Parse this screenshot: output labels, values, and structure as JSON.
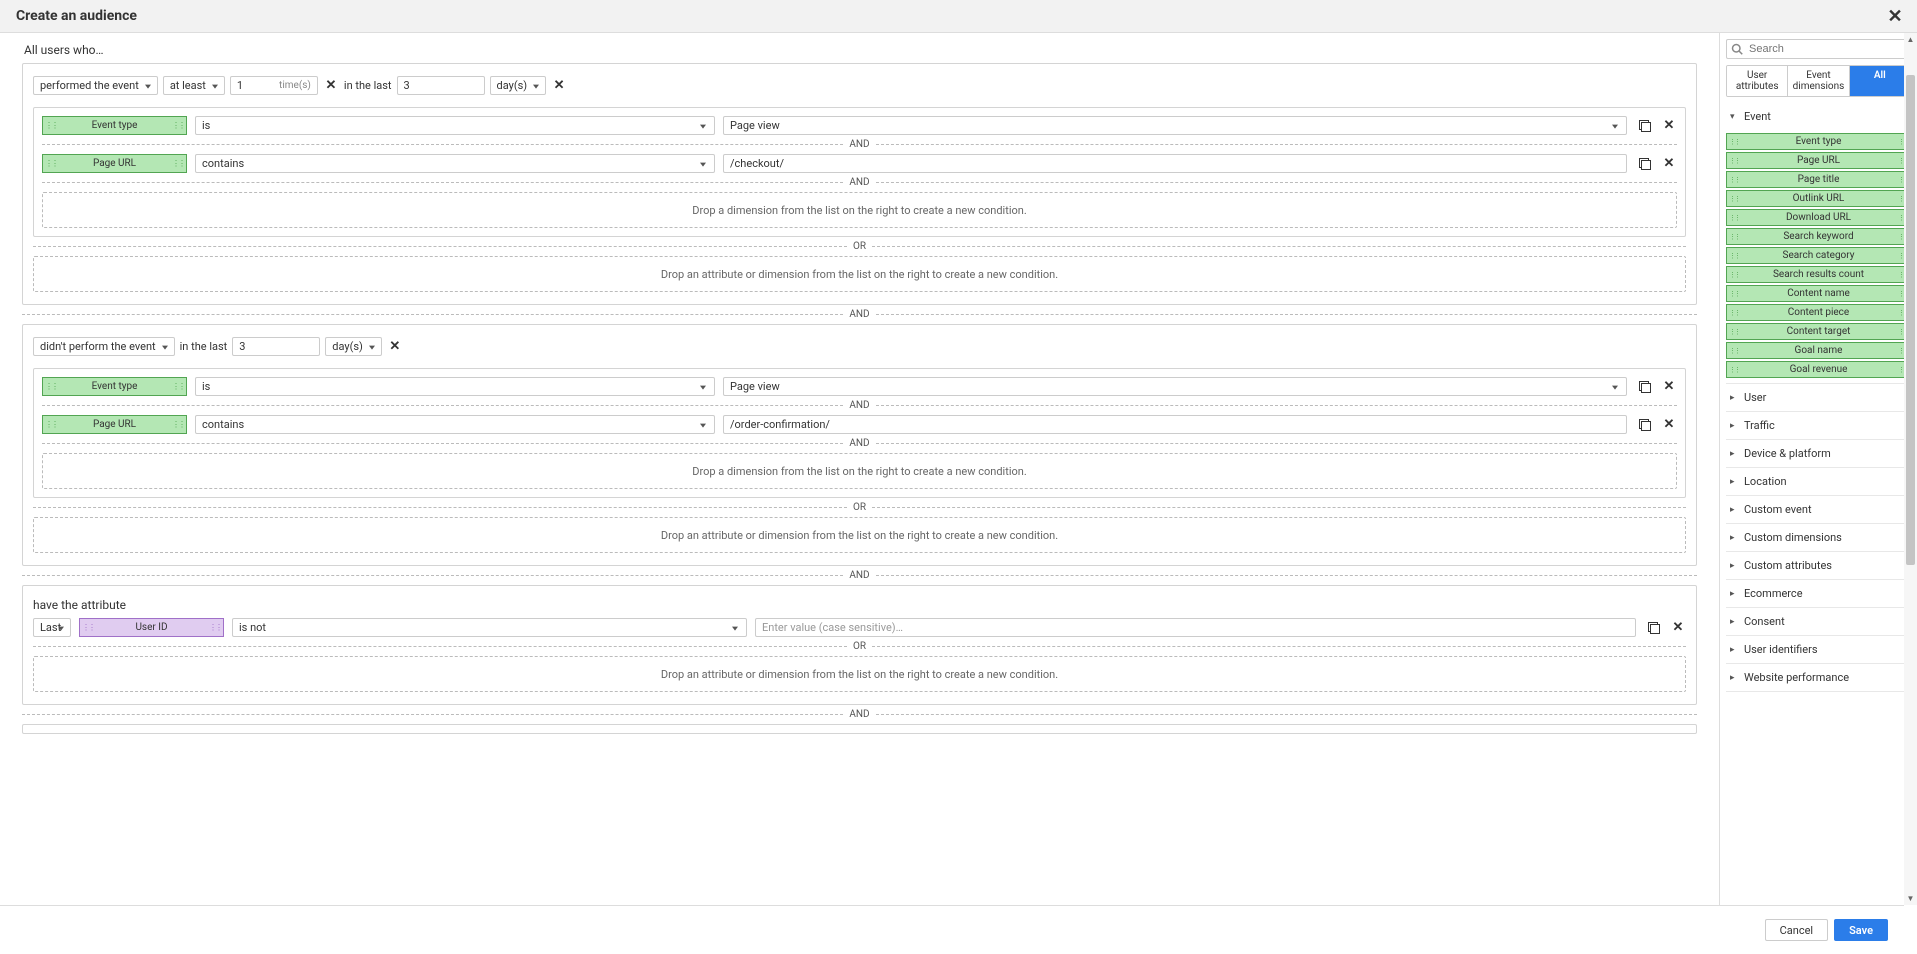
{
  "header": {
    "title": "Create an audience"
  },
  "intro": "All users who…",
  "block1": {
    "event_action": "performed the event",
    "at_least_label": "at least",
    "times_value": "1",
    "times_suffix": "time(s)",
    "in_last_label": "in the last",
    "days_value": "3",
    "days_unit": "day(s)",
    "cond1": {
      "dim": "Event type",
      "op": "is",
      "val": "Page view"
    },
    "cond2": {
      "dim": "Page URL",
      "op": "contains",
      "val": "/checkout/"
    },
    "drop_dim": "Drop a dimension from the list on the right to create a new condition.",
    "drop_attr": "Drop an attribute or dimension from the list on the right to create a new condition."
  },
  "block2": {
    "event_action": "didn't perform the event",
    "in_last_label": "in the last",
    "days_value": "3",
    "days_unit": "day(s)",
    "cond1": {
      "dim": "Event type",
      "op": "is",
      "val": "Page view"
    },
    "cond2": {
      "dim": "Page URL",
      "op": "contains",
      "val": "/order-confirmation/"
    },
    "drop_dim": "Drop a dimension from the list on the right to create a new condition.",
    "drop_attr": "Drop an attribute or dimension from the list on the right to create a new condition."
  },
  "block3": {
    "label": "have the attribute",
    "scope": "Last",
    "attr": "User ID",
    "op": "is not",
    "placeholder": "Enter value (case sensitive)…",
    "drop_attr": "Drop an attribute or dimension from the list on the right to create a new condition."
  },
  "sep": {
    "and": "AND",
    "or": "OR"
  },
  "sidebar": {
    "search_placeholder": "Search",
    "tabs": {
      "user": "User attributes",
      "event": "Event dimensions",
      "all": "All"
    },
    "open_category": "Event",
    "event_items": [
      "Event type",
      "Page URL",
      "Page title",
      "Outlink URL",
      "Download URL",
      "Search keyword",
      "Search category",
      "Search results count",
      "Content name",
      "Content piece",
      "Content target",
      "Goal name",
      "Goal revenue"
    ],
    "categories": [
      "User",
      "Traffic",
      "Device & platform",
      "Location",
      "Custom event",
      "Custom dimensions",
      "Custom attributes",
      "Ecommerce",
      "Consent",
      "User identifiers",
      "Website performance"
    ]
  },
  "footer": {
    "cancel": "Cancel",
    "save": "Save"
  }
}
